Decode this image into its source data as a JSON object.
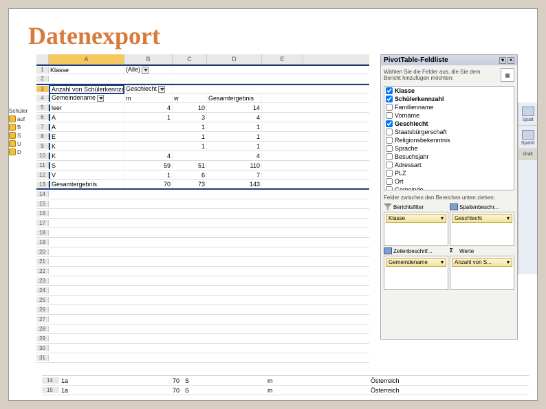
{
  "title": "Datenexport",
  "left_sidebar": {
    "header": "Schüler",
    "items": [
      "auf",
      "B",
      "S",
      "U",
      "D"
    ]
  },
  "columns": [
    "A",
    "B",
    "C",
    "D",
    "E"
  ],
  "cells": {
    "r1": {
      "a": "Klasse",
      "b": "(Alle)"
    },
    "r3": {
      "a": "Anzahl von Schülerkennzahl",
      "b": "Geschlecht"
    },
    "r4": {
      "a": "Gemeindename",
      "b": "m",
      "c": "w",
      "d": "Gesamtergebnis"
    },
    "r5": {
      "a": "leer",
      "b": "4",
      "c": "10",
      "d": "14"
    },
    "r6": {
      "a": "A",
      "b": "1",
      "c": "3",
      "d": "4"
    },
    "r7": {
      "a": "A",
      "b": "",
      "c": "1",
      "d": "1"
    },
    "r8": {
      "a": "E",
      "b": "",
      "c": "1",
      "d": "1"
    },
    "r9": {
      "a": "K",
      "b": "",
      "c": "1",
      "d": "1"
    },
    "r10": {
      "a": "K",
      "b": "4",
      "c": "",
      "d": "4"
    },
    "r11": {
      "a": "S",
      "b": "59",
      "c": "51",
      "d": "110"
    },
    "r12": {
      "a": "V",
      "b": "1",
      "c": "6",
      "d": "7"
    },
    "r13": {
      "a": "Gesamtergebnis",
      "b": "70",
      "c": "73",
      "d": "143"
    }
  },
  "fieldlist": {
    "title": "PivotTable-Feldliste",
    "hint": "Wählen Sie die Felder aus, die Sie dem Bericht hinzufügen möchten:",
    "fields": [
      {
        "label": "Klasse",
        "checked": true
      },
      {
        "label": "Schülerkennzahl",
        "checked": true
      },
      {
        "label": "Familienname",
        "checked": false
      },
      {
        "label": "Vorname",
        "checked": false
      },
      {
        "label": "Geschlecht",
        "checked": true
      },
      {
        "label": "Staatsbürgerschaft",
        "checked": false
      },
      {
        "label": "Religionsbekenntnis",
        "checked": false
      },
      {
        "label": "Sprache",
        "checked": false
      },
      {
        "label": "Besuchsjahr",
        "checked": false
      },
      {
        "label": "Adressart",
        "checked": false
      },
      {
        "label": "PLZ",
        "checked": false
      },
      {
        "label": "Ort",
        "checked": false
      },
      {
        "label": "Gemeinde",
        "checked": false
      }
    ],
    "drag_hint": "Felder zwischen den Bereichen unten ziehen:",
    "areas": {
      "filter": {
        "label": "Berichtsfilter",
        "items": [
          "Klasse"
        ]
      },
      "col": {
        "label": "Spaltenbeschr...",
        "items": [
          "Geschlecht"
        ]
      },
      "row": {
        "label": "Zeilenbeschrif...",
        "items": [
          "Gemeindename"
        ]
      },
      "val": {
        "label": "Werte",
        "items": [
          "Anzahl von S..."
        ]
      }
    }
  },
  "ribbon": {
    "g1": "Spalt",
    "g2": "Sparkl",
    "g3": "shalt"
  },
  "bottom": {
    "r14": {
      "n": "14",
      "a": "1a",
      "b": "70",
      "c": "S",
      "d": "m",
      "e": "Österreich"
    },
    "r15": {
      "n": "15",
      "a": "1a",
      "b": "70",
      "c": "S",
      "d": "m",
      "e": "Österreich"
    }
  }
}
